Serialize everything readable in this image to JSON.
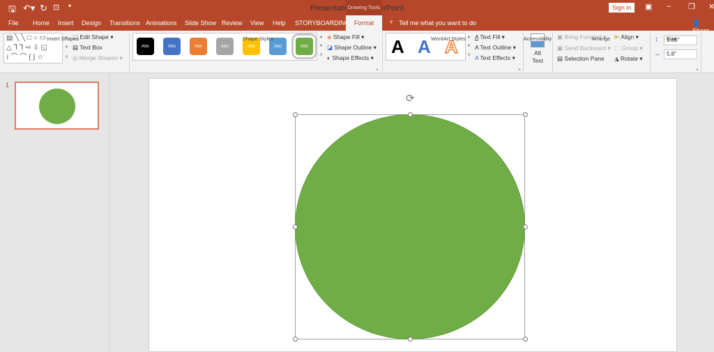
{
  "window": {
    "title": "Presentation1 - PowerPoint",
    "context_tab": "Drawing Tools",
    "sign_in": "Sign in",
    "share": "Share"
  },
  "tabs": [
    "File",
    "Home",
    "Insert",
    "Design",
    "Transitions",
    "Animations",
    "Slide Show",
    "Review",
    "View",
    "Help",
    "STORYBOARDING",
    "Format"
  ],
  "active_tab": "Format",
  "tell_me": "Tell me what you want to do",
  "ribbon": {
    "insert_shapes": {
      "label": "Insert Shapes",
      "edit_shape": "Edit Shape",
      "text_box": "Text Box",
      "merge_shapes": "Merge Shapes"
    },
    "shape_styles": {
      "label": "Shape Styles",
      "swatch_text": "Abc",
      "swatches": [
        "#000000",
        "#4472c4",
        "#ed7d31",
        "#a5a5a5",
        "#ffc000",
        "#5b9bd5",
        "#70ad47"
      ],
      "selected_index": 6,
      "shape_fill": "Shape Fill",
      "shape_outline": "Shape Outline",
      "shape_effects": "Shape Effects"
    },
    "wordart": {
      "label": "WordArt Styles",
      "letter": "A",
      "text_fill": "Text Fill",
      "text_outline": "Text Outline",
      "text_effects": "Text Effects"
    },
    "accessibility": {
      "label": "Accessibility",
      "alt_text_1": "Alt",
      "alt_text_2": "Text"
    },
    "arrange": {
      "label": "Arrange",
      "bring_forward": "Bring Forward",
      "send_backward": "Send Backward",
      "selection_pane": "Selection Pane",
      "align": "Align",
      "group": "Group",
      "rotate": "Rotate"
    },
    "size": {
      "label": "Size",
      "height": "5.66\"",
      "width": "5.8\""
    }
  },
  "slides": [
    {
      "number": "1"
    }
  ],
  "shape": {
    "type": "oval",
    "fill": "#70ad47",
    "outline": "#5f9a3a"
  },
  "colors": {
    "accent": "#b7472a"
  }
}
